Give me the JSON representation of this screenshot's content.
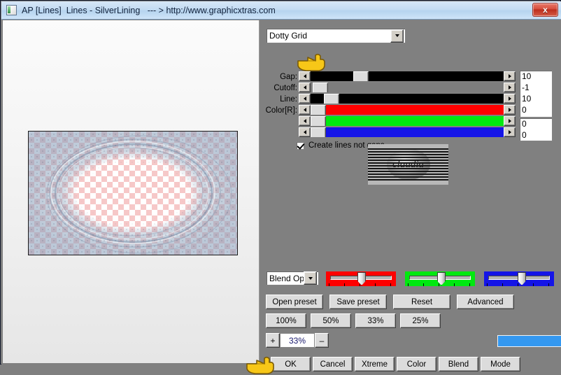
{
  "window": {
    "title": "AP [Lines]  Lines - SilverLining   --- > http://www.graphicxtras.com",
    "app_icon": "app-icon",
    "close_label": "x"
  },
  "preset": {
    "selected": "Dotty Grid",
    "dropdown_icon": "chevron-down-icon"
  },
  "sliders": [
    {
      "label": "Gap:",
      "value": "10",
      "fill": "#000000",
      "thumb_pct": 22
    },
    {
      "label": "Cutoff:",
      "value": "-1",
      "fill": "#7d7d7d",
      "thumb_pct": 1
    },
    {
      "label": "Line:",
      "value": "10",
      "fill": "#000000",
      "thumb_pct": 7
    },
    {
      "label": "Color[R]:",
      "value": "0",
      "fill": "#fe0000",
      "thumb_pct": 1
    },
    {
      "label": "",
      "value": "0",
      "fill": "#00e810",
      "thumb_pct": 1
    },
    {
      "label": "",
      "value": "0",
      "fill": "#1414e6",
      "thumb_pct": 1
    }
  ],
  "checkbox": {
    "label": "Create lines not gaps",
    "checked": true
  },
  "preview": {
    "logo_text": "claudia"
  },
  "blend": {
    "selected": "Blend Opti",
    "dropdown_icon": "chevron-down-icon"
  },
  "rgb_trackbars": [
    {
      "name": "red",
      "color": "#fe0000",
      "thumb_pct": 45
    },
    {
      "name": "green",
      "color": "#00e810",
      "thumb_pct": 46
    },
    {
      "name": "blue",
      "color": "#1414e6",
      "thumb_pct": 48
    }
  ],
  "preset_buttons": [
    {
      "label": "Open preset"
    },
    {
      "label": "Save preset"
    },
    {
      "label": "Reset"
    },
    {
      "label": "Advanced"
    }
  ],
  "zoom_buttons": [
    {
      "label": "100%"
    },
    {
      "label": "50%"
    },
    {
      "label": "33%"
    },
    {
      "label": "25%"
    }
  ],
  "zoom_stepper": {
    "plus": "+",
    "value": "33%",
    "minus": "–"
  },
  "color_swatch": {
    "color": "#3498f0"
  },
  "action_buttons": [
    {
      "label": "OK"
    },
    {
      "label": "Cancel"
    },
    {
      "label": "Xtreme"
    },
    {
      "label": "Color"
    },
    {
      "label": "Blend"
    },
    {
      "label": "Mode"
    }
  ],
  "cursors": [
    {
      "name": "hand-cursor-preset"
    },
    {
      "name": "hand-cursor-ok"
    }
  ]
}
